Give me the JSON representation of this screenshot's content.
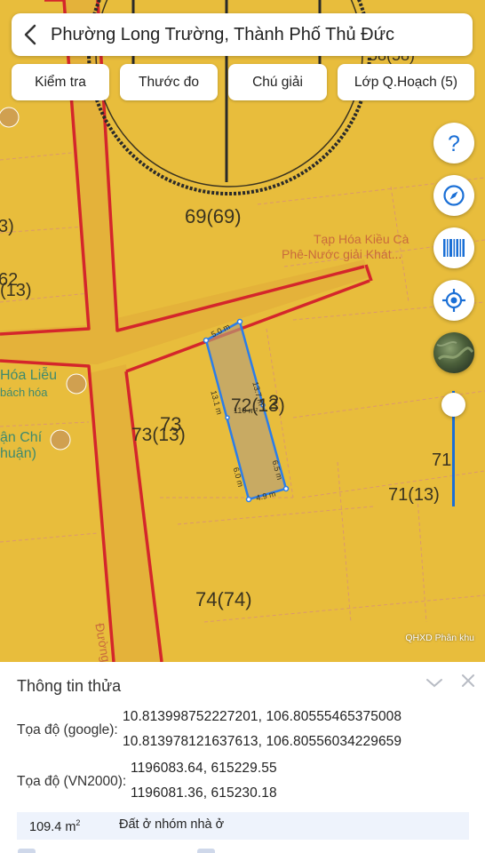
{
  "header": {
    "title": "Phường Long Trường, Thành Phố Thủ Đức"
  },
  "toolbar": {
    "check": "Kiểm tra",
    "ruler": "Thước đo",
    "legend": "Chú giải",
    "layers": "Lớp Q.Hoạch (5)"
  },
  "map": {
    "parcels": {
      "p69": "69(69)",
      "p73": "73",
      "p73_13": "73(13)",
      "p72_13": "72(13)",
      "p2": "2",
      "p74": "74(74)",
      "p71": "71",
      "p71_13": "71(13)",
      "p62": "62",
      "p13": "(13)",
      "p3": "3)",
      "p58": "58(58)"
    },
    "pois": {
      "shop_line1": "Tạp Hóa Kiều Cà",
      "shop_line2": "Phê-Nước giải Khát...",
      "hoa_lieu": "Hóa Liễu",
      "bach_hoa": "bách hóa",
      "an_chi": "ận Chí",
      "thuan": "huận)",
      "road": "Đường"
    },
    "plot": {
      "top": "5.0 m",
      "left": "13.1 m",
      "right": "13.7 m",
      "lower_left": "6.0 m",
      "lower_right": "6.5 m",
      "bottom": "4.9 m",
      "area": "110 m²"
    },
    "layer_tag": "QHXD Phân khu",
    "colors": {
      "base": "#e8bd3c",
      "road": "#d4262b",
      "plot": "#2b7de9"
    }
  },
  "side_buttons": [
    "help-icon",
    "compass-icon",
    "barcode-icon",
    "locate-icon",
    "satellite-icon"
  ],
  "panel": {
    "title": "Thông tin thửa",
    "google_label": "Tọa độ (google):",
    "google_1": "10.813998752227201, 106.80555465375008",
    "google_2": "10.813978121637613, 106.80556034229659",
    "vn_label": "Tọa độ (VN2000):",
    "vn_1": "1196083.64, 615229.55",
    "vn_2": "1196081.36, 615230.18",
    "area": "109.4 m",
    "area_unit": "2",
    "land_type": "Đất ở nhóm nhà ở"
  }
}
